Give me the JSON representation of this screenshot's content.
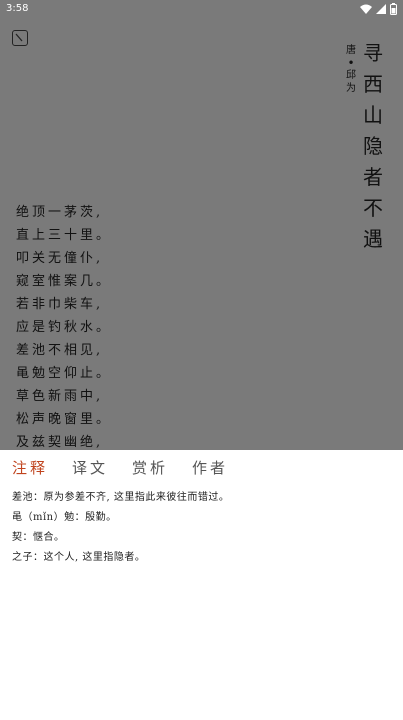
{
  "status": {
    "time": "3:58"
  },
  "poem": {
    "title": [
      "寻",
      "西",
      "山",
      "隐",
      "者",
      "不",
      "遇"
    ],
    "author": {
      "dynasty": "唐",
      "separator": "•",
      "name": [
        "邱",
        "为"
      ]
    },
    "lines": [
      "绝顶一茅茨,",
      "直上三十里。",
      "叩关无僮仆,",
      "窥室惟案几。",
      "若非巾柴车,",
      "应是钓秋水。",
      "差池不相见,",
      "黾勉空仰止。",
      "草色新雨中,",
      "松声晚窗里。",
      "及兹契幽绝,"
    ]
  },
  "tabs": [
    {
      "label": "注释",
      "active": true
    },
    {
      "label": "译文",
      "active": false
    },
    {
      "label": "赏析",
      "active": false
    },
    {
      "label": "作者",
      "active": false
    }
  ],
  "notes": [
    "差池：原为参差不齐, 这里指此来彼往而错过。",
    "黾（mǐn）勉：殷勤。",
    "契：惬合。",
    "之子：这个人, 这里指隐者。"
  ],
  "colors": {
    "overlay": "#7a7a7a",
    "accent": "#c0441e"
  },
  "icons": {
    "menu": "menu-icon",
    "wifi": "wifi-icon",
    "signal": "signal-icon",
    "battery": "battery-icon"
  }
}
